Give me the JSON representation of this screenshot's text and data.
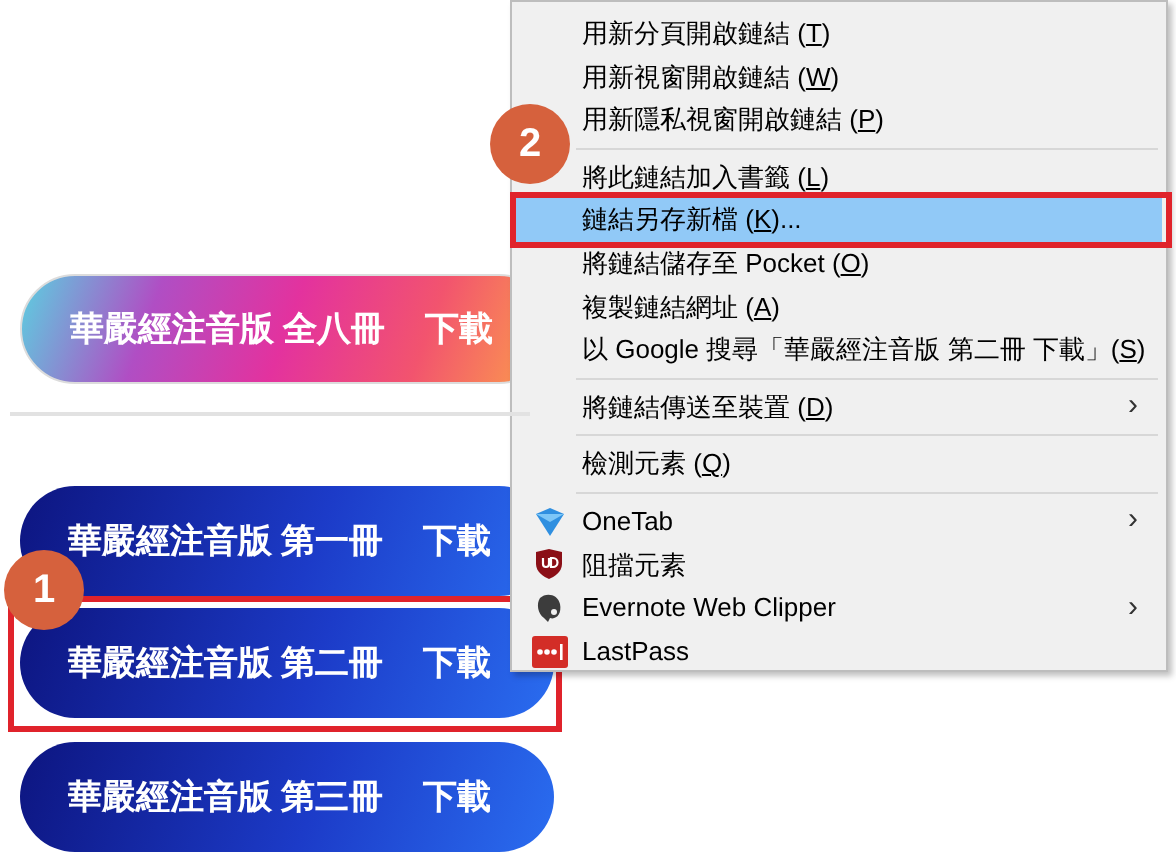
{
  "download_buttons": [
    {
      "title": "華嚴經注音版 全八冊",
      "action": "下載",
      "kind": "rainbow"
    },
    {
      "title": "華嚴經注音版 第一冊",
      "action": "下載",
      "kind": "blue"
    },
    {
      "title": "華嚴經注音版 第二冊",
      "action": "下載",
      "kind": "blue",
      "highlighted": true,
      "step": "1"
    },
    {
      "title": "華嚴經注音版 第三冊",
      "action": "下載",
      "kind": "blue"
    }
  ],
  "context_menu": {
    "step": "2",
    "items": [
      {
        "kind": "item",
        "label": "用新分頁開啟鏈結 (",
        "access_key": "T",
        "after": ")",
        "selected": false
      },
      {
        "kind": "item",
        "label": "用新視窗開啟鏈結 (",
        "access_key": "W",
        "after": ")",
        "selected": false
      },
      {
        "kind": "item",
        "label": "用新隱私視窗開啟鏈結 (",
        "access_key": "P",
        "after": ")",
        "selected": false
      },
      {
        "kind": "separator"
      },
      {
        "kind": "item",
        "label": "將此鏈結加入書籤 (",
        "access_key": "L",
        "after": ")",
        "selected": false
      },
      {
        "kind": "item",
        "label": "鏈結另存新檔 (",
        "access_key": "K",
        "after": ")...",
        "selected": true
      },
      {
        "kind": "item",
        "label": "將鏈結儲存至 Pocket (",
        "access_key": "O",
        "after": ")",
        "selected": false
      },
      {
        "kind": "item",
        "label": "複製鏈結網址 (",
        "access_key": "A",
        "after": ")",
        "selected": false
      },
      {
        "kind": "item",
        "label": "以 Google 搜尋「華嚴經注音版 第二冊 下載」(",
        "access_key": "S",
        "after": ")",
        "selected": false
      },
      {
        "kind": "separator"
      },
      {
        "kind": "item",
        "label": "將鏈結傳送至裝置 (",
        "access_key": "D",
        "after": ")",
        "submenu_arrow": "›",
        "selected": false
      },
      {
        "kind": "separator"
      },
      {
        "kind": "item",
        "label": "檢測元素 (",
        "access_key": "Q",
        "after": ")",
        "selected": false
      },
      {
        "kind": "separator"
      },
      {
        "kind": "extension",
        "label": "OneTab",
        "submenu_arrow": "›",
        "selected": false
      },
      {
        "kind": "extension",
        "label": "阻擋元素",
        "selected": false
      },
      {
        "kind": "extension",
        "label": "Evernote Web Clipper",
        "submenu_arrow": "›",
        "selected": false
      },
      {
        "kind": "extension",
        "label": "LastPass",
        "selected": false
      }
    ]
  }
}
